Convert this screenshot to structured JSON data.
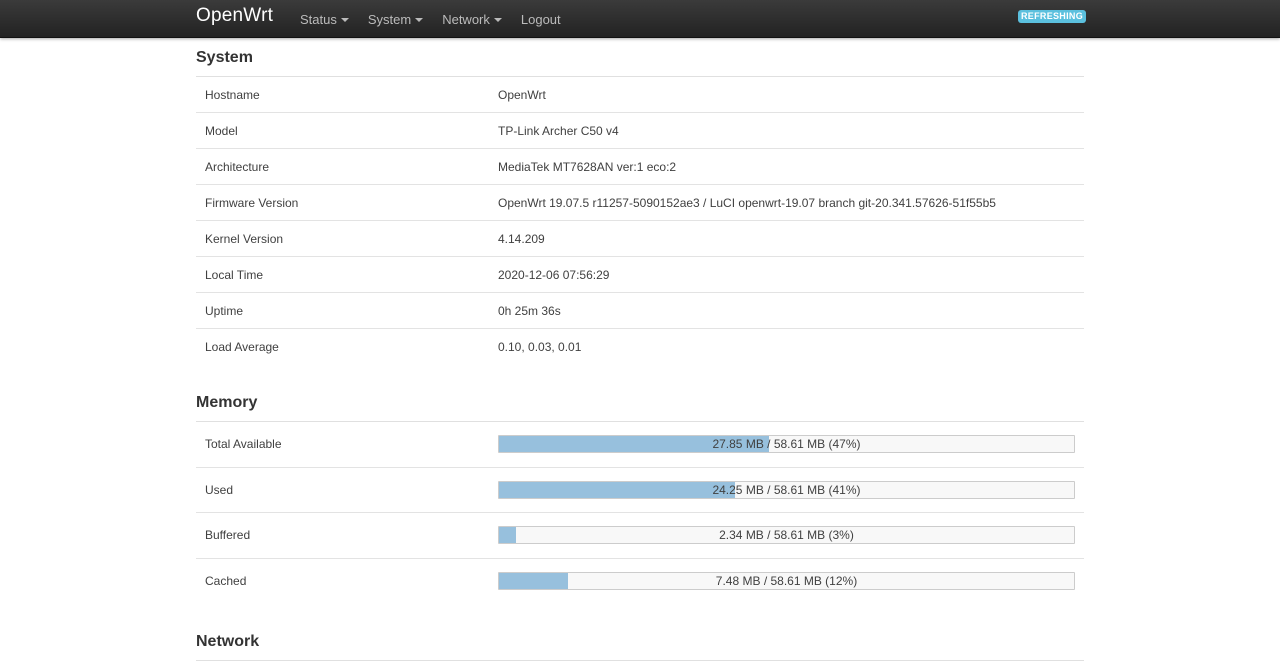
{
  "navbar": {
    "brand": "OpenWrt",
    "menu": [
      {
        "label": "Status",
        "has_dropdown": true
      },
      {
        "label": "System",
        "has_dropdown": true
      },
      {
        "label": "Network",
        "has_dropdown": true
      },
      {
        "label": "Logout",
        "has_dropdown": false
      }
    ],
    "status_badge": "REFRESHING"
  },
  "system": {
    "title": "System",
    "rows": [
      {
        "label": "Hostname",
        "value": "OpenWrt"
      },
      {
        "label": "Model",
        "value": "TP-Link Archer C50 v4"
      },
      {
        "label": "Architecture",
        "value": "MediaTek MT7628AN ver:1 eco:2"
      },
      {
        "label": "Firmware Version",
        "value": "OpenWrt 19.07.5 r11257-5090152ae3 / LuCI openwrt-19.07 branch git-20.341.57626-51f55b5"
      },
      {
        "label": "Kernel Version",
        "value": "4.14.209"
      },
      {
        "label": "Local Time",
        "value": "2020-12-06 07:56:29"
      },
      {
        "label": "Uptime",
        "value": "0h 25m 36s"
      },
      {
        "label": "Load Average",
        "value": "0.10, 0.03, 0.01"
      }
    ]
  },
  "memory": {
    "title": "Memory",
    "rows": [
      {
        "label": "Total Available",
        "text": "27.85 MB / 58.61 MB (47%)",
        "percent": 47
      },
      {
        "label": "Used",
        "text": "24.25 MB / 58.61 MB (41%)",
        "percent": 41
      },
      {
        "label": "Buffered",
        "text": "2.34 MB / 58.61 MB (3%)",
        "percent": 3
      },
      {
        "label": "Cached",
        "text": "7.48 MB / 58.61 MB (12%)",
        "percent": 12
      }
    ]
  },
  "network": {
    "title": "Network"
  },
  "colors": {
    "navbar_bg": "#2d2d2d",
    "badge_bg": "#5bc0de",
    "bar_fill": "#97c0dd"
  }
}
